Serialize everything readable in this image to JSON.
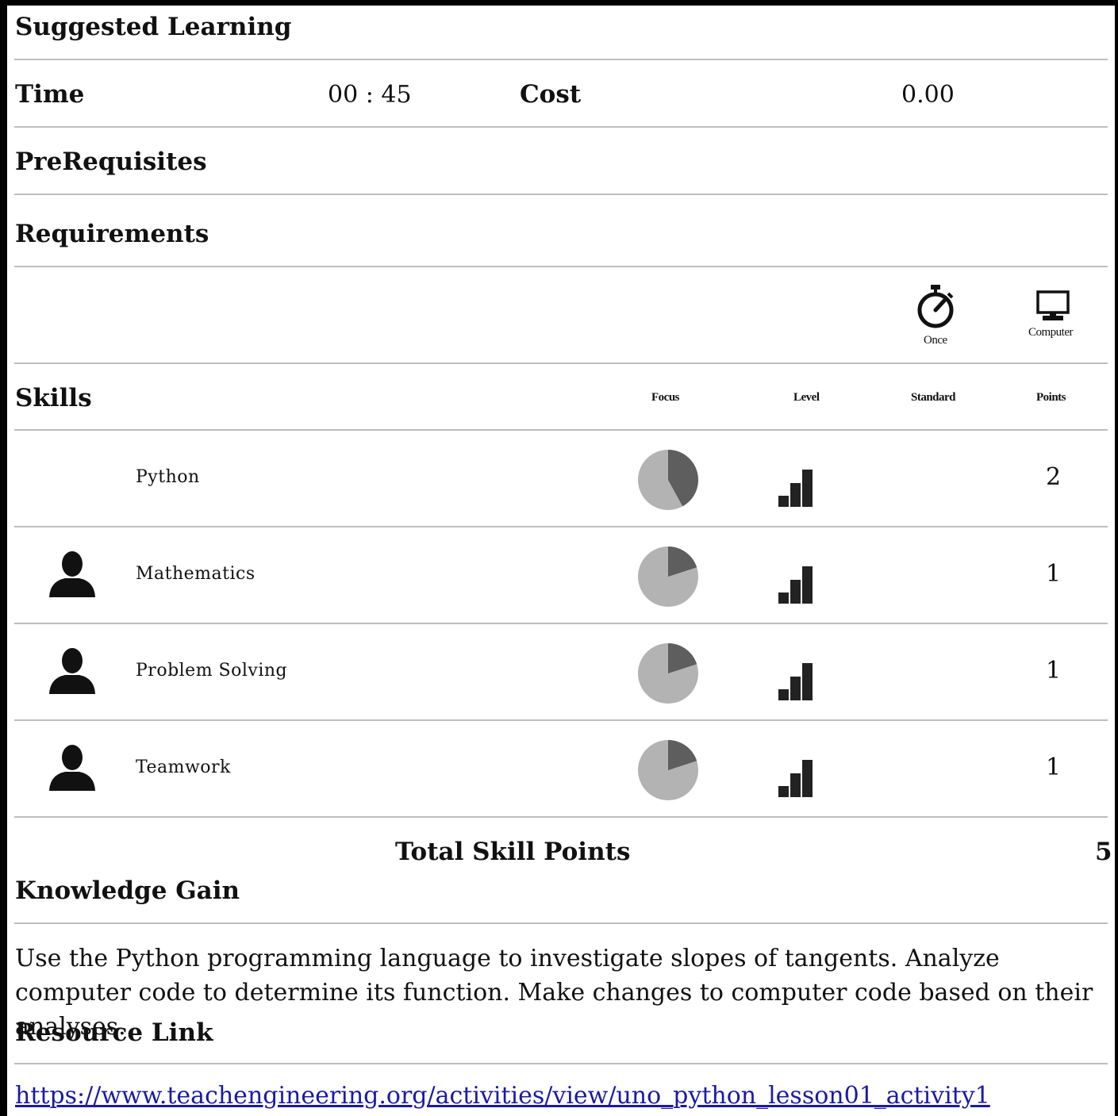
{
  "header": {
    "title": "Suggested Learning"
  },
  "summary": {
    "time_label": "Time",
    "time_value": "00 : 45",
    "cost_label": "Cost",
    "cost_value": "0.00"
  },
  "prerequisites": {
    "label": "PreRequisites"
  },
  "requirements": {
    "label": "Requirements",
    "items": [
      {
        "icon": "stopwatch-icon",
        "label": "Once"
      },
      {
        "icon": "computer-monitor-icon",
        "label": "Computer"
      }
    ]
  },
  "skills": {
    "label": "Skills",
    "columns": {
      "focus": "Focus",
      "level": "Level",
      "standard": "Standard",
      "points": "Points"
    },
    "rows": [
      {
        "name": "Python",
        "icon": "",
        "focus_fraction": 0.42,
        "level": 3,
        "points": "2"
      },
      {
        "name": "Mathematics",
        "icon": "person-icon",
        "focus_fraction": 0.2,
        "level": 3,
        "points": "1"
      },
      {
        "name": "Problem Solving",
        "icon": "person-icon",
        "focus_fraction": 0.2,
        "level": 3,
        "points": "1"
      },
      {
        "name": "Teamwork",
        "icon": "person-icon",
        "focus_fraction": 0.2,
        "level": 3,
        "points": "1"
      }
    ],
    "total_label": "Total Skill Points",
    "total_value": "5"
  },
  "knowledge": {
    "label": "Knowledge Gain",
    "text": "Use the Python programming language to investigate slopes of tangents. Analyze computer code to determine its function. Make changes to computer code based on their analyses."
  },
  "resource": {
    "label": "Resource Link",
    "url": "https://www.teachengineering.org/activities/view/uno_python_lesson01_activity1"
  },
  "colors": {
    "pie_light": "#b3b3b3",
    "pie_dark": "#5e5e5e",
    "link": "#1a1aa6"
  }
}
